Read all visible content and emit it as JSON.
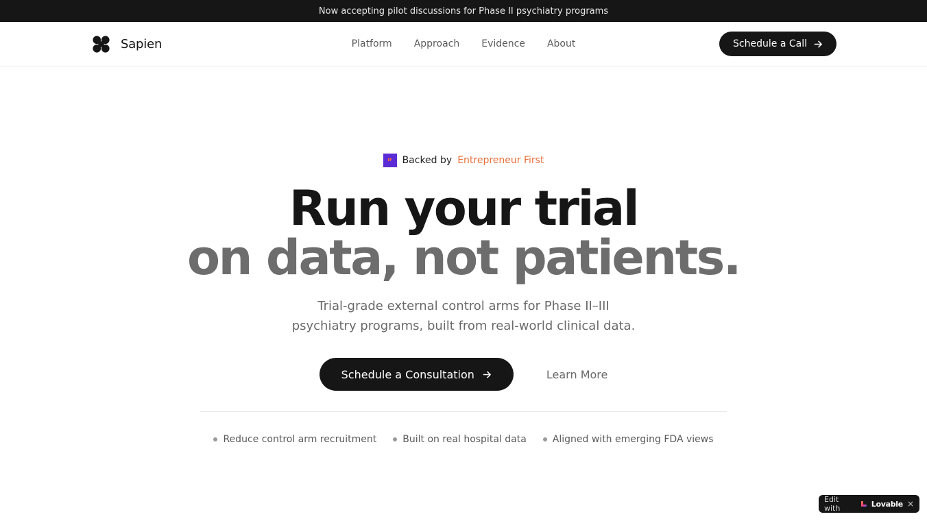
{
  "announcement": "Now accepting pilot discussions for Phase II psychiatry programs",
  "brand": {
    "name": "Sapien",
    "icon": "four-circles-logo-icon"
  },
  "nav": {
    "links": [
      "Platform",
      "Approach",
      "Evidence",
      "About"
    ],
    "cta_label": "Schedule a Call",
    "cta_icon": "arrow-right-icon"
  },
  "hero": {
    "backed_prefix": "Backed by",
    "backed_name": "Entrepreneur First",
    "backed_logo_text": "EF",
    "headline_line1": "Run your trial",
    "headline_line2": "on data, not patients.",
    "subheadline": "Trial-grade external control arms for Phase II–III psychiatry programs, built from real-world clinical data.",
    "primary_cta": "Schedule a Consultation",
    "secondary_cta": "Learn More"
  },
  "features": [
    "Reduce control arm recruitment",
    "Built on real hospital data",
    "Aligned with emerging FDA views"
  ],
  "badge": {
    "prefix": "Edit with",
    "brand": "Lovable",
    "close": "×"
  },
  "colors": {
    "accent": "#e8703a",
    "dark": "#161616",
    "muted": "#6d6d6d",
    "ef_purple": "#5b2bd6"
  }
}
